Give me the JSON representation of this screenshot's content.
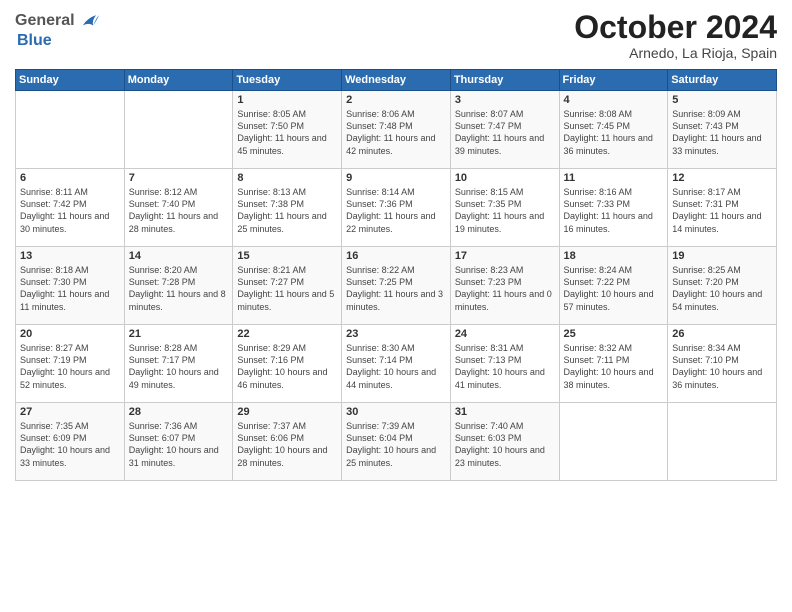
{
  "header": {
    "logo_general": "General",
    "logo_blue": "Blue",
    "month_title": "October 2024",
    "location": "Arnedo, La Rioja, Spain"
  },
  "weekdays": [
    "Sunday",
    "Monday",
    "Tuesday",
    "Wednesday",
    "Thursday",
    "Friday",
    "Saturday"
  ],
  "weeks": [
    [
      {
        "day": "",
        "info": ""
      },
      {
        "day": "",
        "info": ""
      },
      {
        "day": "1",
        "info": "Sunrise: 8:05 AM\nSunset: 7:50 PM\nDaylight: 11 hours and 45 minutes."
      },
      {
        "day": "2",
        "info": "Sunrise: 8:06 AM\nSunset: 7:48 PM\nDaylight: 11 hours and 42 minutes."
      },
      {
        "day": "3",
        "info": "Sunrise: 8:07 AM\nSunset: 7:47 PM\nDaylight: 11 hours and 39 minutes."
      },
      {
        "day": "4",
        "info": "Sunrise: 8:08 AM\nSunset: 7:45 PM\nDaylight: 11 hours and 36 minutes."
      },
      {
        "day": "5",
        "info": "Sunrise: 8:09 AM\nSunset: 7:43 PM\nDaylight: 11 hours and 33 minutes."
      }
    ],
    [
      {
        "day": "6",
        "info": "Sunrise: 8:11 AM\nSunset: 7:42 PM\nDaylight: 11 hours and 30 minutes."
      },
      {
        "day": "7",
        "info": "Sunrise: 8:12 AM\nSunset: 7:40 PM\nDaylight: 11 hours and 28 minutes."
      },
      {
        "day": "8",
        "info": "Sunrise: 8:13 AM\nSunset: 7:38 PM\nDaylight: 11 hours and 25 minutes."
      },
      {
        "day": "9",
        "info": "Sunrise: 8:14 AM\nSunset: 7:36 PM\nDaylight: 11 hours and 22 minutes."
      },
      {
        "day": "10",
        "info": "Sunrise: 8:15 AM\nSunset: 7:35 PM\nDaylight: 11 hours and 19 minutes."
      },
      {
        "day": "11",
        "info": "Sunrise: 8:16 AM\nSunset: 7:33 PM\nDaylight: 11 hours and 16 minutes."
      },
      {
        "day": "12",
        "info": "Sunrise: 8:17 AM\nSunset: 7:31 PM\nDaylight: 11 hours and 14 minutes."
      }
    ],
    [
      {
        "day": "13",
        "info": "Sunrise: 8:18 AM\nSunset: 7:30 PM\nDaylight: 11 hours and 11 minutes."
      },
      {
        "day": "14",
        "info": "Sunrise: 8:20 AM\nSunset: 7:28 PM\nDaylight: 11 hours and 8 minutes."
      },
      {
        "day": "15",
        "info": "Sunrise: 8:21 AM\nSunset: 7:27 PM\nDaylight: 11 hours and 5 minutes."
      },
      {
        "day": "16",
        "info": "Sunrise: 8:22 AM\nSunset: 7:25 PM\nDaylight: 11 hours and 3 minutes."
      },
      {
        "day": "17",
        "info": "Sunrise: 8:23 AM\nSunset: 7:23 PM\nDaylight: 11 hours and 0 minutes."
      },
      {
        "day": "18",
        "info": "Sunrise: 8:24 AM\nSunset: 7:22 PM\nDaylight: 10 hours and 57 minutes."
      },
      {
        "day": "19",
        "info": "Sunrise: 8:25 AM\nSunset: 7:20 PM\nDaylight: 10 hours and 54 minutes."
      }
    ],
    [
      {
        "day": "20",
        "info": "Sunrise: 8:27 AM\nSunset: 7:19 PM\nDaylight: 10 hours and 52 minutes."
      },
      {
        "day": "21",
        "info": "Sunrise: 8:28 AM\nSunset: 7:17 PM\nDaylight: 10 hours and 49 minutes."
      },
      {
        "day": "22",
        "info": "Sunrise: 8:29 AM\nSunset: 7:16 PM\nDaylight: 10 hours and 46 minutes."
      },
      {
        "day": "23",
        "info": "Sunrise: 8:30 AM\nSunset: 7:14 PM\nDaylight: 10 hours and 44 minutes."
      },
      {
        "day": "24",
        "info": "Sunrise: 8:31 AM\nSunset: 7:13 PM\nDaylight: 10 hours and 41 minutes."
      },
      {
        "day": "25",
        "info": "Sunrise: 8:32 AM\nSunset: 7:11 PM\nDaylight: 10 hours and 38 minutes."
      },
      {
        "day": "26",
        "info": "Sunrise: 8:34 AM\nSunset: 7:10 PM\nDaylight: 10 hours and 36 minutes."
      }
    ],
    [
      {
        "day": "27",
        "info": "Sunrise: 7:35 AM\nSunset: 6:09 PM\nDaylight: 10 hours and 33 minutes."
      },
      {
        "day": "28",
        "info": "Sunrise: 7:36 AM\nSunset: 6:07 PM\nDaylight: 10 hours and 31 minutes."
      },
      {
        "day": "29",
        "info": "Sunrise: 7:37 AM\nSunset: 6:06 PM\nDaylight: 10 hours and 28 minutes."
      },
      {
        "day": "30",
        "info": "Sunrise: 7:39 AM\nSunset: 6:04 PM\nDaylight: 10 hours and 25 minutes."
      },
      {
        "day": "31",
        "info": "Sunrise: 7:40 AM\nSunset: 6:03 PM\nDaylight: 10 hours and 23 minutes."
      },
      {
        "day": "",
        "info": ""
      },
      {
        "day": "",
        "info": ""
      }
    ]
  ]
}
